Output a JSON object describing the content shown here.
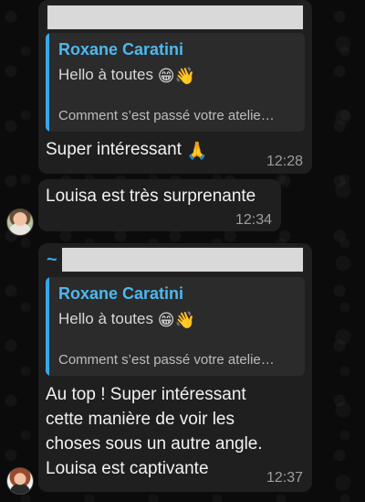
{
  "messages": [
    {
      "quote": {
        "author": "Roxane Caratini",
        "line1": "Hello à toutes",
        "line1_emojis": "😁👋",
        "line2": "Comment s’est passé votre atelie…"
      },
      "text": "Super intéressant",
      "text_emoji": "🙏",
      "time": "12:28"
    },
    {
      "text": "Louisa est très surprenante",
      "time": "12:34"
    },
    {
      "sender_prefix": "~",
      "quote": {
        "author": "Roxane Caratini",
        "line1": "Hello à toutes",
        "line1_emojis": "😁👋",
        "line2": "Comment s’est passé votre atelie…"
      },
      "lines": [
        "Au top ! Super intéressant",
        "cette manière de voir les",
        "choses sous un autre angle.",
        "Louisa est captivante"
      ],
      "time": "12:37"
    }
  ],
  "colors": {
    "background": "#0b0b0b",
    "bubble": "#1f1f1f",
    "quote_bg": "#2b2b2b",
    "accent": "#35a9e6",
    "time": "#9e9e9e"
  },
  "icons": [
    "avatar"
  ]
}
